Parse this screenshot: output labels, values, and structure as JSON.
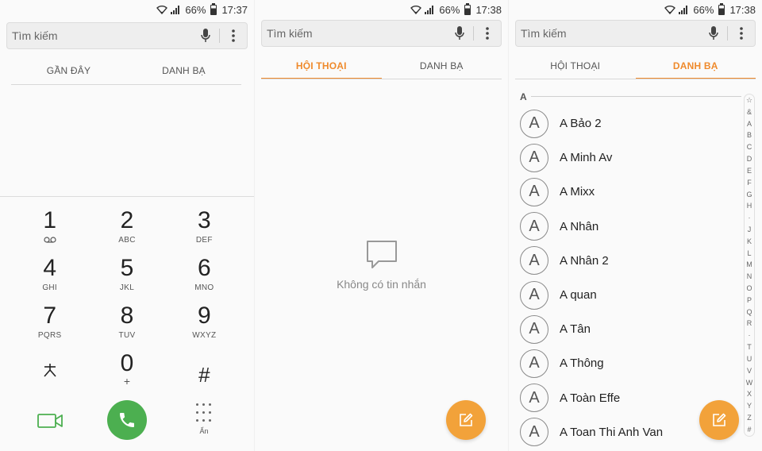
{
  "screens": {
    "dialer": {
      "status": {
        "battery": "66%",
        "time": "17:37"
      },
      "search_placeholder": "Tìm kiếm",
      "tabs": [
        "GẦN ĐÂY",
        "DANH BẠ"
      ],
      "keys": [
        {
          "digit": "1",
          "sub": "voicemail-icon"
        },
        {
          "digit": "2",
          "sub": "ABC"
        },
        {
          "digit": "3",
          "sub": "DEF"
        },
        {
          "digit": "4",
          "sub": "GHI"
        },
        {
          "digit": "5",
          "sub": "JKL"
        },
        {
          "digit": "6",
          "sub": "MNO"
        },
        {
          "digit": "7",
          "sub": "PQRS"
        },
        {
          "digit": "8",
          "sub": "TUV"
        },
        {
          "digit": "9",
          "sub": "WXYZ"
        },
        {
          "digit": "*",
          "sub": ""
        },
        {
          "digit": "0",
          "sub": "+"
        },
        {
          "digit": "#",
          "sub": ""
        }
      ],
      "hide_label": "Ẩn",
      "call_color": "#4caf50",
      "video_color": "#4caf50"
    },
    "messages": {
      "status": {
        "battery": "66%",
        "time": "17:38"
      },
      "search_placeholder": "Tìm kiếm",
      "tabs": [
        "HỘI THOẠI",
        "DANH BẠ"
      ],
      "active_tab": 0,
      "empty_text": "Không có tin nhắn",
      "fab_color": "#f2a23a"
    },
    "contacts": {
      "status": {
        "battery": "66%",
        "time": "17:38"
      },
      "search_placeholder": "Tìm kiếm",
      "tabs": [
        "HỘI THOẠI",
        "DANH BẠ"
      ],
      "active_tab": 1,
      "section": "A",
      "contacts": [
        {
          "initial": "A",
          "name": "A Bảo 2"
        },
        {
          "initial": "A",
          "name": "A Minh Av"
        },
        {
          "initial": "A",
          "name": "A Mixx"
        },
        {
          "initial": "A",
          "name": "A Nhân"
        },
        {
          "initial": "A",
          "name": "A Nhân 2"
        },
        {
          "initial": "A",
          "name": "A quan"
        },
        {
          "initial": "A",
          "name": "A Tân"
        },
        {
          "initial": "A",
          "name": "A Thông"
        },
        {
          "initial": "A",
          "name": "A Toàn Effe"
        },
        {
          "initial": "A",
          "name": "A Toan Thi Anh Van"
        }
      ],
      "index": [
        "☆",
        "&",
        "A",
        "B",
        "C",
        "D",
        "E",
        "F",
        "G",
        "H",
        "·",
        "J",
        "K",
        "L",
        "M",
        "N",
        "O",
        "P",
        "Q",
        "R",
        "·",
        "T",
        "U",
        "V",
        "W",
        "X",
        "Y",
        "Z",
        "#"
      ]
    }
  },
  "accent_color": "#ef8a2c"
}
